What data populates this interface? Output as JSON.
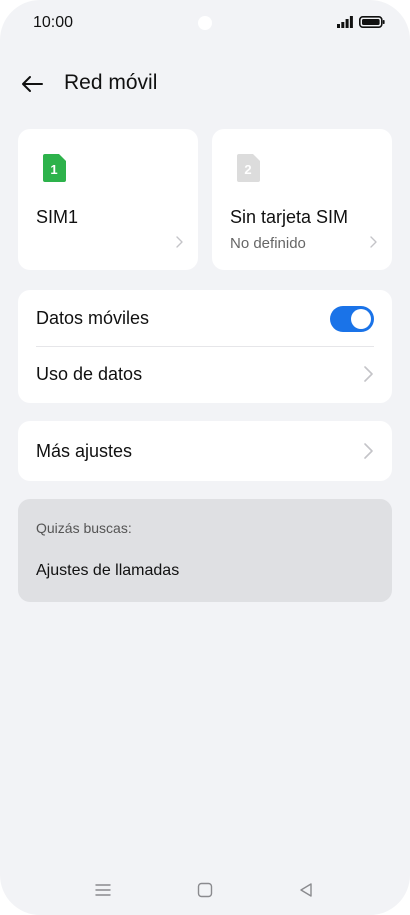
{
  "status_bar": {
    "time": "10:00"
  },
  "header": {
    "title": "Red móvil"
  },
  "sims": [
    {
      "badge": "1",
      "label": "SIM1",
      "sub": "",
      "color": "#2db24b"
    },
    {
      "badge": "2",
      "label": "Sin tarjeta SIM",
      "sub": "No definido",
      "color": "#d9d9d9"
    }
  ],
  "datos": {
    "mobile_data_label": "Datos móviles",
    "mobile_data_enabled": true,
    "usage_label": "Uso de datos"
  },
  "more_settings": {
    "label": "Más ajustes"
  },
  "suggestions": {
    "title": "Quizás buscas:",
    "items": [
      "Ajustes de llamadas"
    ]
  },
  "colors": {
    "accent": "#1a73e8",
    "background": "#f2f3f6"
  }
}
